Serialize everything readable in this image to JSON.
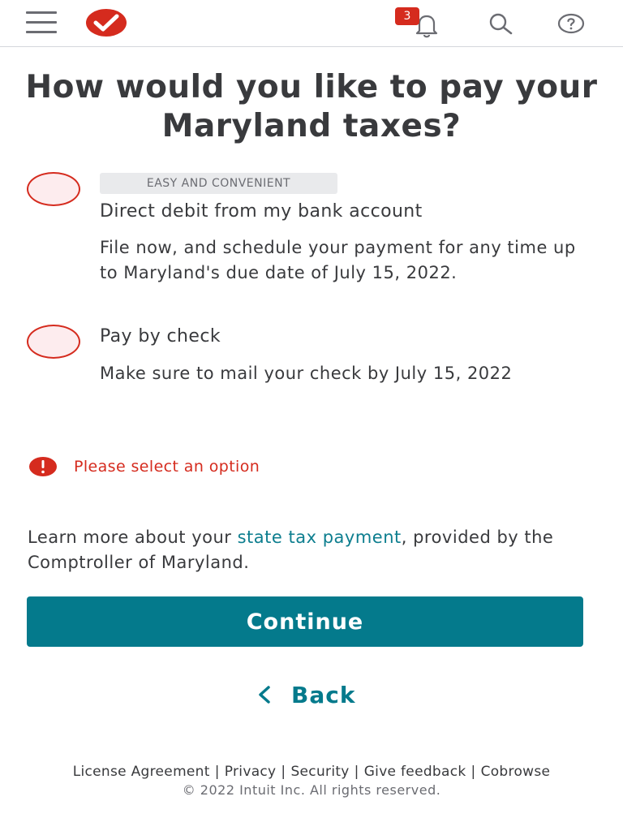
{
  "header": {
    "notification_count": "3",
    "icons": [
      "hamburger-menu-icon",
      "turbotax-check-logo",
      "bell-icon",
      "search-icon",
      "help-icon"
    ],
    "brand_color": "#d52b1e"
  },
  "page": {
    "title": "How would you like to pay your Maryland taxes?"
  },
  "options": [
    {
      "tag": "EASY AND CONVENIENT",
      "label": "Direct debit from my bank account",
      "description": "File now, and schedule your payment for any time up to Maryland's due date of July 15, 2022.",
      "selected": false
    },
    {
      "label": "Pay by check",
      "description": "Make sure to mail your check by July 15, 2022",
      "selected": false
    }
  ],
  "error": {
    "message": "Please select an option",
    "color": "#d52b1e"
  },
  "learn_more": {
    "prefix": "Learn more about your ",
    "link_text": "state tax payment",
    "suffix": ", provided by the Comptroller of Maryland."
  },
  "actions": {
    "continue_label": "Continue",
    "back_label": "Back",
    "primary_color": "#047a8c"
  },
  "footer": {
    "links": [
      "License Agreement",
      "Privacy",
      "Security",
      "Give feedback",
      "Cobrowse"
    ],
    "copyright": "© 2022 Intuit Inc. All rights reserved."
  }
}
